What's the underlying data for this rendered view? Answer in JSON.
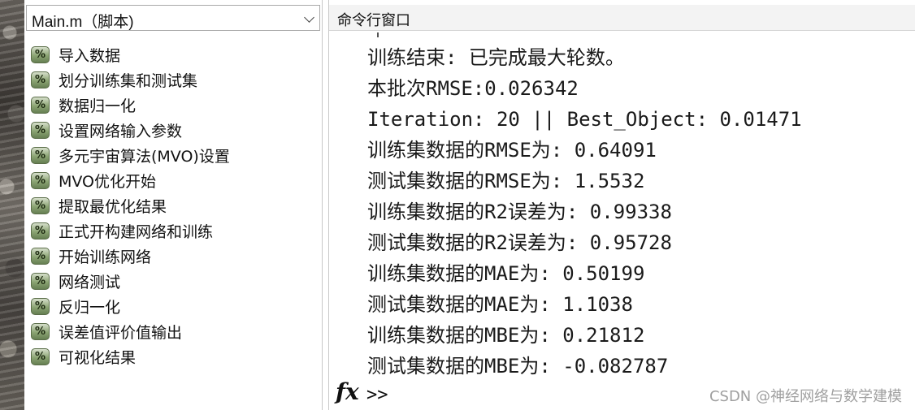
{
  "left_panel": {
    "file_title": "Main.m（脚本)",
    "section_icon_text": "%",
    "sections": [
      {
        "label": "导入数据"
      },
      {
        "label": "划分训练集和测试集"
      },
      {
        "label": "数据归一化"
      },
      {
        "label": "设置网络输入参数"
      },
      {
        "label": "多元宇宙算法(MVO)设置"
      },
      {
        "label": "MVO优化开始"
      },
      {
        "label": "提取最优化结果"
      },
      {
        "label": "正式开构建网络和训练"
      },
      {
        "label": "开始训练网络"
      },
      {
        "label": "网络测试"
      },
      {
        "label": "反归一化"
      },
      {
        "label": "误差值评价值输出"
      },
      {
        "label": "可视化结果"
      }
    ]
  },
  "command_window": {
    "title": "命令行窗口",
    "output_lines": [
      "训练结束: 已完成最大轮数。",
      "本批次RMSE:0.026342",
      "Iteration: 20 || Best_Object: 0.01471",
      "训练集数据的RMSE为: 0.64091",
      "测试集数据的RMSE为: 1.5532",
      "训练集数据的R2误差为: 0.99338",
      "测试集数据的R2误差为: 0.95728",
      "训练集数据的MAE为: 0.50199",
      "测试集数据的MAE为: 1.1038",
      "训练集数据的MBE为: 0.21812",
      "测试集数据的MBE为: -0.082787"
    ],
    "fx_label": "fx",
    "prompt": ">>"
  },
  "watermark": "CSDN @神经网络与数学建模"
}
